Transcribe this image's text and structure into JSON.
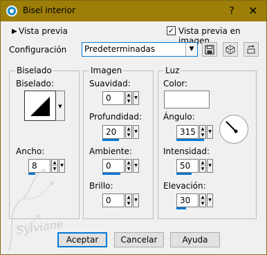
{
  "window": {
    "title": "Bisel interior",
    "help_label": "?",
    "close_label": "✕",
    "titlebar_color": "#9c7e08"
  },
  "preview": {
    "arrow_icon": "triangle-right-icon",
    "label": "Vista previa",
    "checkbox_label": "Vista previa en imagen",
    "checkbox_checked": true
  },
  "config": {
    "label": "Configuración",
    "selected": "Predeterminadas",
    "tools": [
      "save-icon",
      "random-icon",
      "reset-icon"
    ]
  },
  "bevel_group": {
    "title": "Biselado",
    "bevel_label": "Biselado:",
    "width_label": "Ancho:",
    "width_value": "8"
  },
  "image_group": {
    "title": "Imagen",
    "smoothness_label": "Suavidad:",
    "smoothness_value": "0",
    "depth_label": "Profundidad:",
    "depth_value": "20",
    "ambience_label": "Ambiente:",
    "ambience_value": "0",
    "shininess_label": "Brillo:",
    "shininess_value": "0"
  },
  "light_group": {
    "title": "Luz",
    "color_label": "Color:",
    "color_value": "#ffffff",
    "angle_label": "Ángulo:",
    "angle_value": "315",
    "intensity_label": "Intensidad:",
    "intensity_value": "50",
    "elevation_label": "Elevación:",
    "elevation_value": "30"
  },
  "buttons": {
    "ok": "Aceptar",
    "cancel": "Cancelar",
    "help": "Ayuda"
  },
  "watermark": {
    "signature": "Sylviane"
  },
  "accent_color": "#0078d7"
}
